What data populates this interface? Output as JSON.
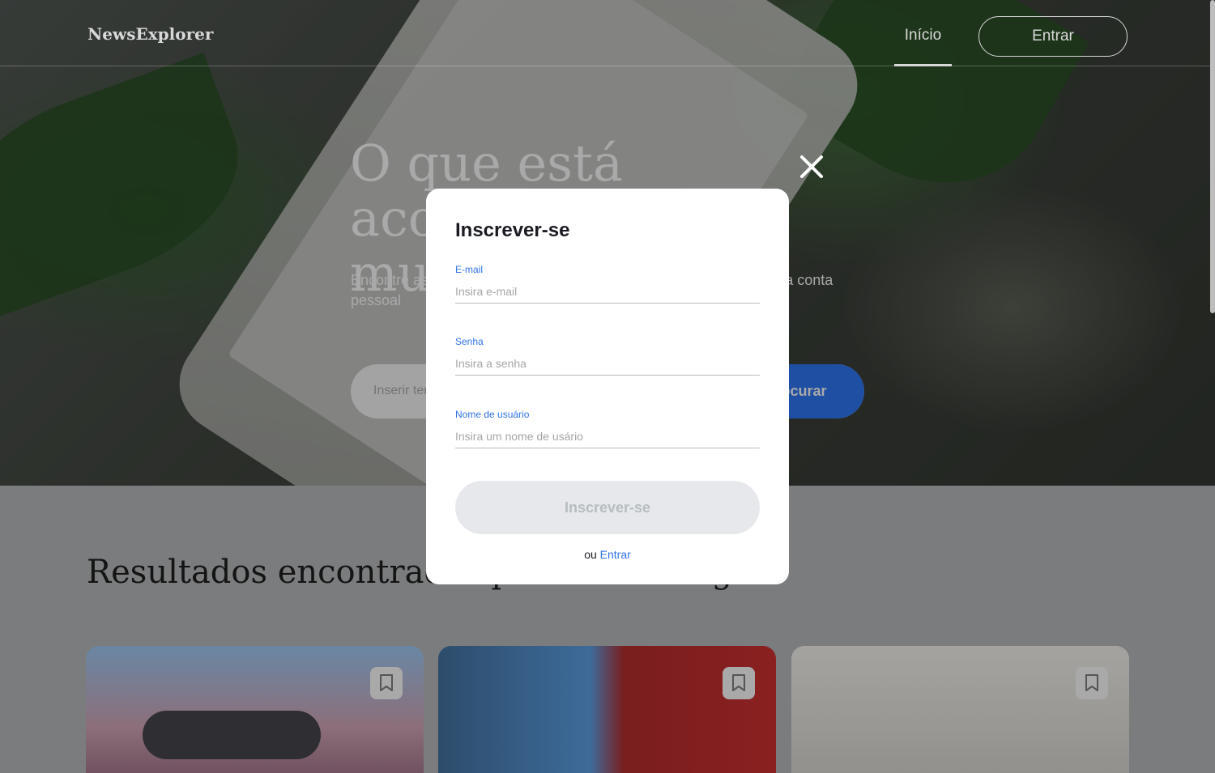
{
  "header": {
    "logo": "NewsExplorer",
    "nav_home": "Início",
    "nav_login": "Entrar"
  },
  "hero": {
    "title": "O que está acontecendo no mundo?",
    "subtitle": "Encontre as últimas notícias sobre qualquer tema e salve-as em sua conta pessoal",
    "search_placeholder": "Inserir tema",
    "search_button": "Procurar"
  },
  "results": {
    "title": "Resultados encontrados para \"tecnologia\"",
    "cards": [
      {
        "icon": "bookmark-icon"
      },
      {
        "icon": "bookmark-icon"
      },
      {
        "icon": "bookmark-icon"
      }
    ]
  },
  "modal": {
    "title": "Inscrever-se",
    "email_label": "E-mail",
    "email_placeholder": "Insira e-mail",
    "password_label": "Senha",
    "password_placeholder": "Insira a senha",
    "username_label": "Nome de usuário",
    "username_placeholder": "Insira um nome de usário",
    "submit_label": "Inscrever-se",
    "alt_prefix": "ou",
    "alt_link": "Entrar",
    "close_icon": "close-icon"
  },
  "colors": {
    "accent": "#2f71e5",
    "disabled_button": "#e6e8eb",
    "disabled_text": "#b6bcbf"
  }
}
